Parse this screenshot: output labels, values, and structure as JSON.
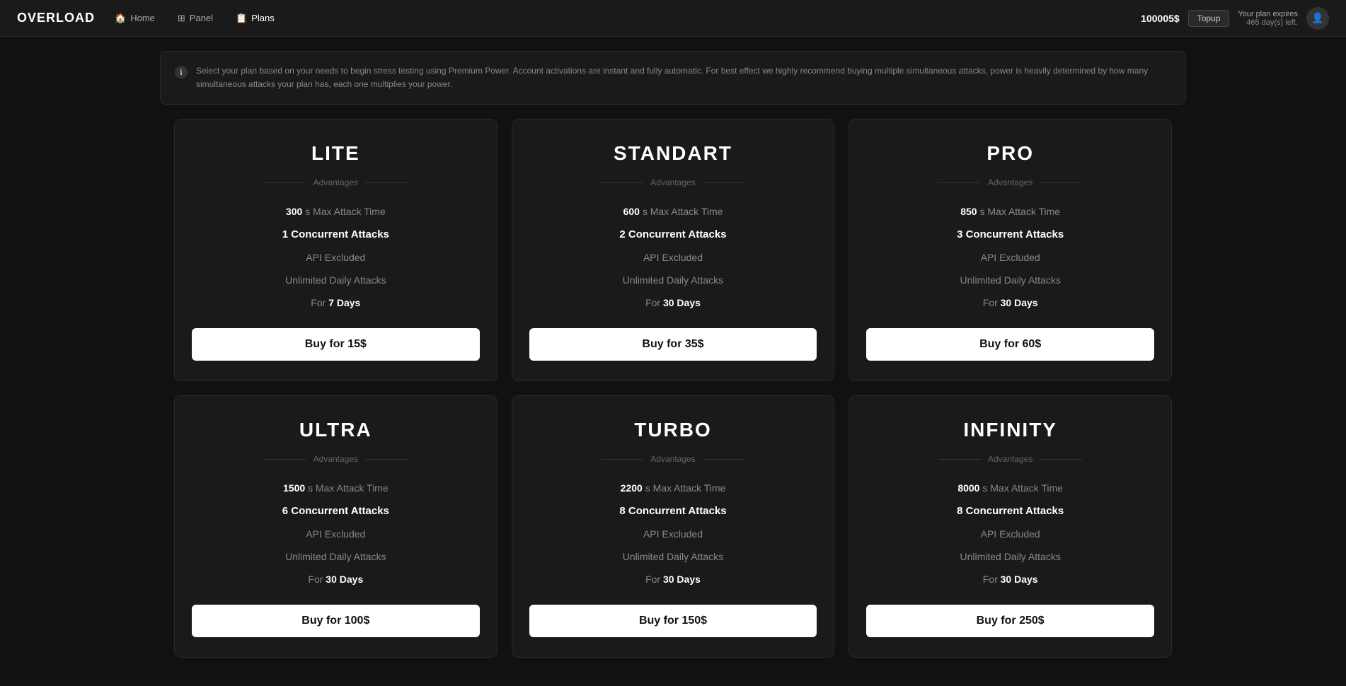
{
  "brand": "OVERLOAD",
  "nav": {
    "items": [
      {
        "label": "Home",
        "icon": "🏠",
        "active": false
      },
      {
        "label": "Panel",
        "icon": "⊞",
        "active": false
      },
      {
        "label": "Plans",
        "icon": "📋",
        "active": true
      }
    ]
  },
  "header": {
    "balance": "100005$",
    "topup_label": "Topup",
    "expiry_label": "Your plan expires",
    "expiry_value": "465 day(s) left."
  },
  "info_box": {
    "text": "Select your plan based on your needs to begin stress testing using Premium Power. Account activations are instant and fully automatic. For best effect we highly recommend buying multiple simultaneous attacks, power is heavily determined by how many simultaneous attacks your plan has, each one multiplies your power."
  },
  "plans": [
    {
      "name": "LITE",
      "advantages_label": "Advantages",
      "max_attack_time_val": "300",
      "max_attack_time_label": "s Max Attack Time",
      "concurrent_attacks": "1 Concurrent Attacks",
      "api": "API Excluded",
      "daily_attacks": "Unlimited Daily Attacks",
      "duration_prefix": "For",
      "duration": "7 Days",
      "buy_label": "Buy for 15$"
    },
    {
      "name": "STANDART",
      "advantages_label": "Advantages",
      "max_attack_time_val": "600",
      "max_attack_time_label": "s Max Attack Time",
      "concurrent_attacks": "2 Concurrent Attacks",
      "api": "API Excluded",
      "daily_attacks": "Unlimited Daily Attacks",
      "duration_prefix": "For",
      "duration": "30 Days",
      "buy_label": "Buy for 35$"
    },
    {
      "name": "PRO",
      "advantages_label": "Advantages",
      "max_attack_time_val": "850",
      "max_attack_time_label": "s Max Attack Time",
      "concurrent_attacks": "3 Concurrent Attacks",
      "api": "API Excluded",
      "daily_attacks": "Unlimited Daily Attacks",
      "duration_prefix": "For",
      "duration": "30 Days",
      "buy_label": "Buy for 60$"
    },
    {
      "name": "ULTRA",
      "advantages_label": "Advantages",
      "max_attack_time_val": "1500",
      "max_attack_time_label": "s Max Attack Time",
      "concurrent_attacks": "6 Concurrent Attacks",
      "api": "API Excluded",
      "daily_attacks": "Unlimited Daily Attacks",
      "duration_prefix": "For",
      "duration": "30 Days",
      "buy_label": "Buy for 100$"
    },
    {
      "name": "TURBO",
      "advantages_label": "Advantages",
      "max_attack_time_val": "2200",
      "max_attack_time_label": "s Max Attack Time",
      "concurrent_attacks": "8 Concurrent Attacks",
      "api": "API Excluded",
      "daily_attacks": "Unlimited Daily Attacks",
      "duration_prefix": "For",
      "duration": "30 Days",
      "buy_label": "Buy for 150$"
    },
    {
      "name": "INFINITY",
      "advantages_label": "Advantages",
      "max_attack_time_val": "8000",
      "max_attack_time_label": "s Max Attack Time",
      "concurrent_attacks": "8 Concurrent Attacks",
      "api": "API Excluded",
      "daily_attacks": "Unlimited Daily Attacks",
      "duration_prefix": "For",
      "duration": "30 Days",
      "buy_label": "Buy for 250$"
    }
  ]
}
